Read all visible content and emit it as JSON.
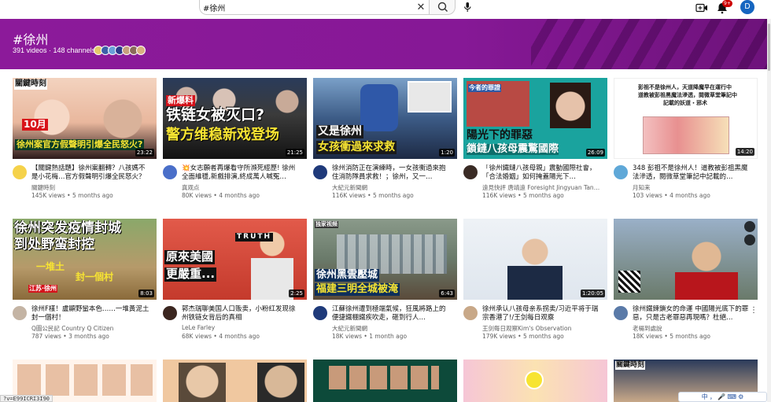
{
  "search": {
    "value": "#徐州",
    "placeholder": "Search"
  },
  "header": {
    "notification_count": "9+",
    "avatar_letter": "D"
  },
  "hashtag": {
    "title": "#徐州",
    "stats": "391 videos · 148 channels"
  },
  "videos": [
    {
      "title": "【關鍵熱話題】徐州案翻轉？八孩媽不是小花梅…官方假聲明引爆全民怒火？",
      "channel": "關鍵時刻",
      "views": "145K views",
      "age": "5 months ago",
      "duration": "23:22"
    },
    {
      "title": "💥女志願者再爆看守所瀕死經歷! 徐州全面維穩,新戲排演,終成萬人喊冤…",
      "channel": "真观点",
      "views": "80K views",
      "age": "4 months ago",
      "duration": "21:25"
    },
    {
      "title": "徐州消防正在演練時，一女孩衝過來抱住消防隊員求救！；徐州，又一…",
      "channel": "大紀元新聞網",
      "views": "116K views",
      "age": "5 months ago",
      "duration": "1:20"
    },
    {
      "title": "「徐州鐵鏈八孩母親」震動國際社會，「合法婚姻」如何掩蓋陽光下…",
      "channel": "遠見快評 唐靖遠 Foresight Jingyuan Tan…",
      "views": "116K views",
      "age": "5 months ago",
      "duration": "26:09"
    },
    {
      "title": "348 彭祖不是徐州人！道教被彭祖黑魔法滲透，閱微草堂筆記中記載的…",
      "channel": "月知来",
      "views": "103 views",
      "age": "4 months ago",
      "duration": "14:20"
    },
    {
      "title": "徐州F樣！盧顯野蠻本色……一堆黃泥土封一個村！",
      "channel": "Q圖公民記 Country Q Citizen",
      "views": "787 views",
      "age": "3 months ago",
      "duration": "8:03"
    },
    {
      "title": "郭杰瑞聊美国人口贩卖，小粉红发现徐州铁链女背后的真相",
      "channel": "LeLe Farley",
      "views": "68K views",
      "age": "4 months ago",
      "duration": "2:25"
    },
    {
      "title": "江蘇徐州遭到極端氣候，狂風將路上的便捷鐵棚鐵疾吹走，砸到行人…",
      "channel": "大紀元新聞網",
      "views": "18K views",
      "age": "1 month ago",
      "duration": "6:43"
    },
    {
      "title": "徐州承认八孩母亲系拐卖/习近平将于瑞宗香港了!/王剑每日观察",
      "channel": "王剑每日观察Kim's Observation",
      "views": "179K views",
      "age": "5 months ago",
      "duration": "1:20:05"
    },
    {
      "title": "徐州鐵鍊鎖女的命運 中國陽光底下的罪惡，只是古老罪惡再現嗎？杜絕…",
      "channel": "老楊到處說",
      "views": "18K views",
      "age": "5 months ago",
      "duration": ""
    }
  ],
  "thumb_text": {
    "t0a": "關鍵時刻",
    "t0b": "徐州案官方假聲明引爆全民怒火?",
    "t0c": "10月",
    "t1a": "新爆料",
    "t1b": "铁链女被灭口?",
    "t1c": "警方维稳新戏登场",
    "t2a": "又是徐州",
    "t2b": "女孩衝過來求救",
    "t3a": "陽光下的罪惡",
    "t3b": "鎖鏈八孩母震驚國際",
    "t3c": "今者的罪證",
    "t4a": "彭祖不是徐州人，天道降魔早在運行中",
    "t4b": "道教被彭祖黑魔法滲透，閱微草堂筆記中",
    "t4c": "記載的妖道・邪术",
    "t5a": "徐州突发疫情封城",
    "t5b": "到处野蛮封控",
    "t5c": "一堆土",
    "t5d": "封一個村",
    "t5e": "江苏·徐州",
    "t6a": "TRUTH",
    "t6b": "原來美國",
    "t6c": "更嚴重...",
    "t7a": "徐州黑雲壓城",
    "t7b": "福建三明全城被淹",
    "t7c": "独家视频",
    "t9a": ""
  },
  "status": {
    "url_tip": "?v=E99ICRI3I90",
    "ime": "中 ， 🎤 ⌨ ⚙"
  },
  "colors": {
    "banner": "#861896",
    "accent_red": "#cc0000"
  }
}
